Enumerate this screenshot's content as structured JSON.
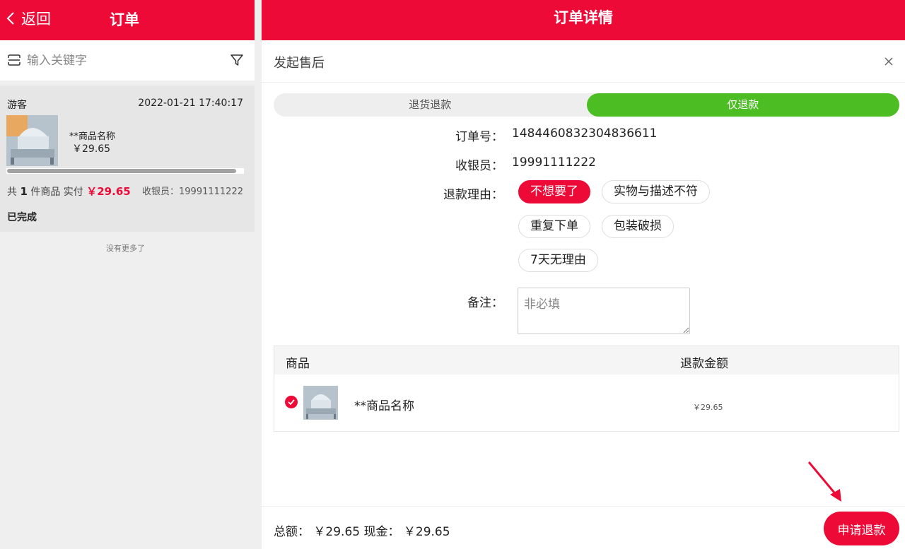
{
  "left": {
    "back_label": "返回",
    "title": "订单",
    "search": {
      "placeholder": "输入关键字"
    },
    "order": {
      "user": "游客",
      "time": "2022-01-21 17:40:17",
      "product_name": "**商品名称",
      "price": "￥29.65",
      "summary_prefix": "共",
      "count": "1",
      "summary_mid": "件商品 实付",
      "paid": "￥29.65",
      "cashier": "收银员：19991111222",
      "status": "已完成"
    },
    "no_more": "没有更多了"
  },
  "right": {
    "title": "订单详情",
    "dialog": {
      "title": "发起售后",
      "tabs": [
        {
          "label": "退货退款",
          "active": false
        },
        {
          "label": "仅退款",
          "active": true
        }
      ],
      "order_no_label": "订单号：",
      "order_no": "1484460832304836611",
      "cashier_label": "收银员：",
      "cashier": "19991111222",
      "reason_label": "退款理由：",
      "reasons": [
        "不想要了",
        "实物与描述不符",
        "重复下单",
        "包装破损",
        "7天无理由"
      ],
      "selected_reason": "不想要了",
      "remark_label": "备注：",
      "remark_placeholder": "非必填",
      "table": {
        "headers": [
          "商品",
          "退款金额"
        ],
        "rows": [
          {
            "name": "**商品名称",
            "amount": "￥29.65",
            "checked": true
          }
        ]
      },
      "footer": {
        "total_text": "总额： ￥29.65 现金： ￥29.65",
        "apply_label": "申请退款"
      }
    }
  },
  "colors": {
    "brand_red": "#ee0a37",
    "active_green": "#4cbd23"
  }
}
